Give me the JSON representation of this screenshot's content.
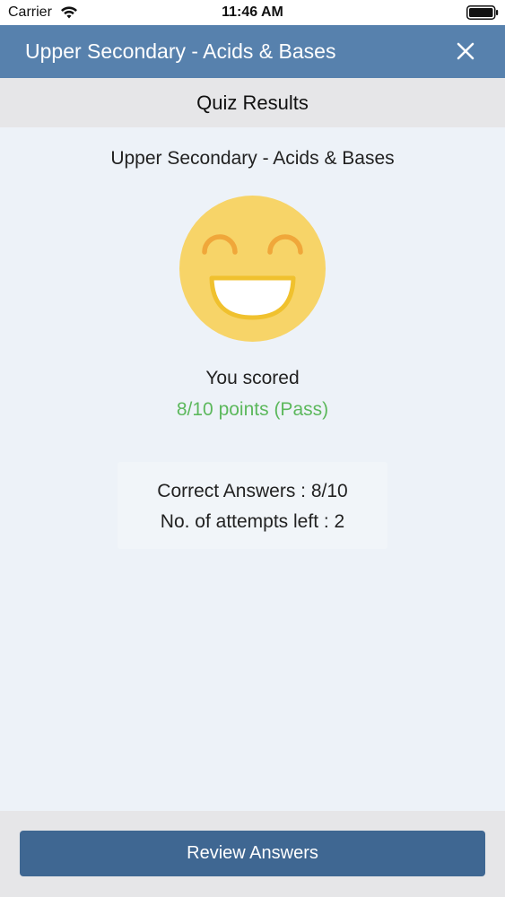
{
  "status_bar": {
    "carrier": "Carrier",
    "time": "11:46 AM",
    "wifi_icon": "wifi-icon",
    "battery_icon": "battery-icon"
  },
  "nav": {
    "title": "Upper Secondary - Acids & Bases",
    "close_icon": "close-icon",
    "background_color": "#5781ad"
  },
  "header": {
    "title": "Quiz Results"
  },
  "results": {
    "quiz_title": "Upper Secondary - Acids & Bases",
    "result_icon": "smiley-face-icon",
    "scored_label": "You scored",
    "score_text": "8/10 points (Pass)",
    "score_color": "#5cb85c",
    "correct_answers": "Correct Answers : 8/10",
    "attempts_left": "No. of attempts left : 2"
  },
  "footer": {
    "review_button_label": "Review Answers",
    "button_color": "#3f6792"
  }
}
